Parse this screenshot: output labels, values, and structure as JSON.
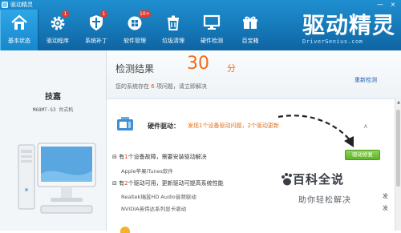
{
  "window": {
    "title": "驱动精灵",
    "controls": [
      "—",
      "×"
    ]
  },
  "nav": [
    {
      "label": "基本状态",
      "icon": "home-icon",
      "badge": ""
    },
    {
      "label": "驱动程序",
      "icon": "gear-icon",
      "badge": "1"
    },
    {
      "label": "系统补丁",
      "icon": "shield-icon",
      "badge": "1"
    },
    {
      "label": "软件管理",
      "icon": "app-grid-icon",
      "badge": "10+"
    },
    {
      "label": "垃圾清理",
      "icon": "trash-icon",
      "badge": ""
    },
    {
      "label": "硬件检测",
      "icon": "monitor-icon",
      "badge": ""
    },
    {
      "label": "百宝箱",
      "icon": "toolbox-icon",
      "badge": ""
    }
  ],
  "brand": {
    "logo_text": "驱动精灵",
    "url": "DriverGenius.com"
  },
  "left_panel": {
    "user": "技嘉",
    "machine": "M68MT-S3 台式机"
  },
  "result": {
    "title": "检测结果",
    "score": "30",
    "score_unit": "分",
    "desc_prefix": "您的系统存在",
    "desc_count": "6",
    "desc_suffix": "项问题，请立即解决",
    "rescan": "重新检测"
  },
  "hardware": {
    "title": "硬件驱动：",
    "desc": "发现1个设备驱动问题，2个驱动更新",
    "collapse": "∧"
  },
  "groups": [
    {
      "toggle": "⊟",
      "prefix": "有",
      "count": "1",
      "suffix": "个设备故障，需要安装驱动解决",
      "items": [
        {
          "name": "Apple苹果iTunes软件",
          "action": ""
        }
      ],
      "button": "驱动修复"
    },
    {
      "toggle": "⊟",
      "prefix": "有",
      "count": "2",
      "suffix": "个驱动可用，更新驱动可提高系统性能",
      "items": [
        {
          "name": "Realtek瑞昱HD Audio音频驱动",
          "action": "发"
        },
        {
          "name": "NVIDIA英伟达系列显卡驱动",
          "action": "发"
        }
      ]
    }
  ],
  "watermark": {
    "title": "百科全说",
    "subtitle": "助你轻松解决"
  },
  "colors": {
    "header_blue": "#1679b9",
    "accent_orange": "#f06d17",
    "issue_red": "#e23b2e",
    "button_green": "#5eb327"
  }
}
